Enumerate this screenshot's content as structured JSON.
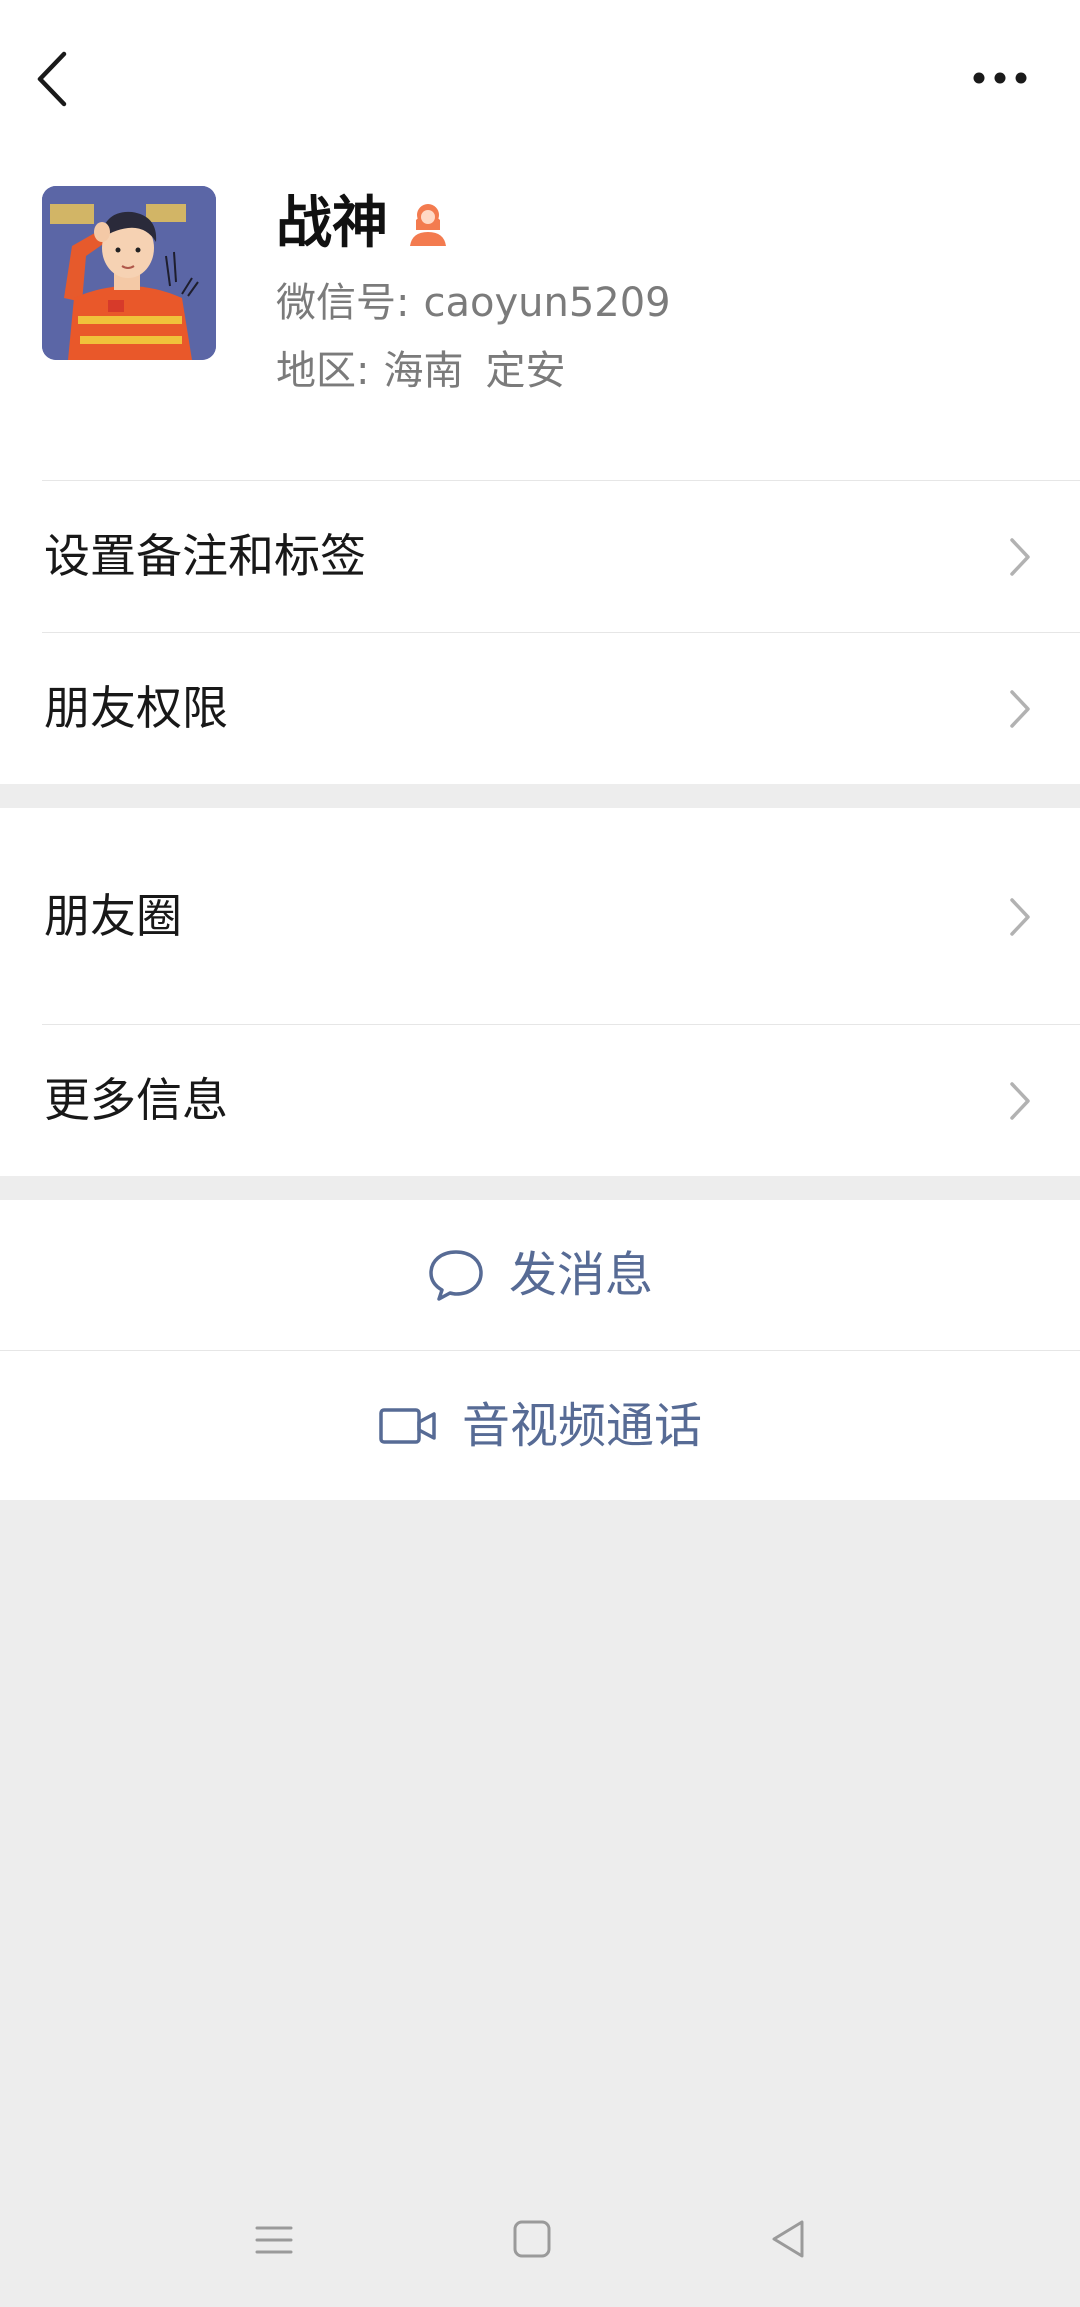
{
  "header": {
    "back_icon": "chevron-left-icon",
    "more_icon": "more-dots-icon"
  },
  "profile": {
    "nickname": "战神",
    "gender_icon": "female-icon",
    "gender_color": "#f37b4f",
    "wechat_id_label": "微信号:",
    "wechat_id": "caoyun5209",
    "region_label": "地区:",
    "region_province": "海南",
    "region_city": "定安"
  },
  "menu": {
    "remark_tags": "设置备注和标签",
    "friend_permissions": "朋友权限",
    "moments": "朋友圈",
    "more_info": "更多信息"
  },
  "actions": {
    "send_message": "发消息",
    "voice_video_call": "音视频通话",
    "accent_color": "#576b95"
  },
  "system_nav": {
    "menu_icon": "recent-apps-icon",
    "home_icon": "home-square-icon",
    "back_icon": "back-triangle-icon"
  }
}
